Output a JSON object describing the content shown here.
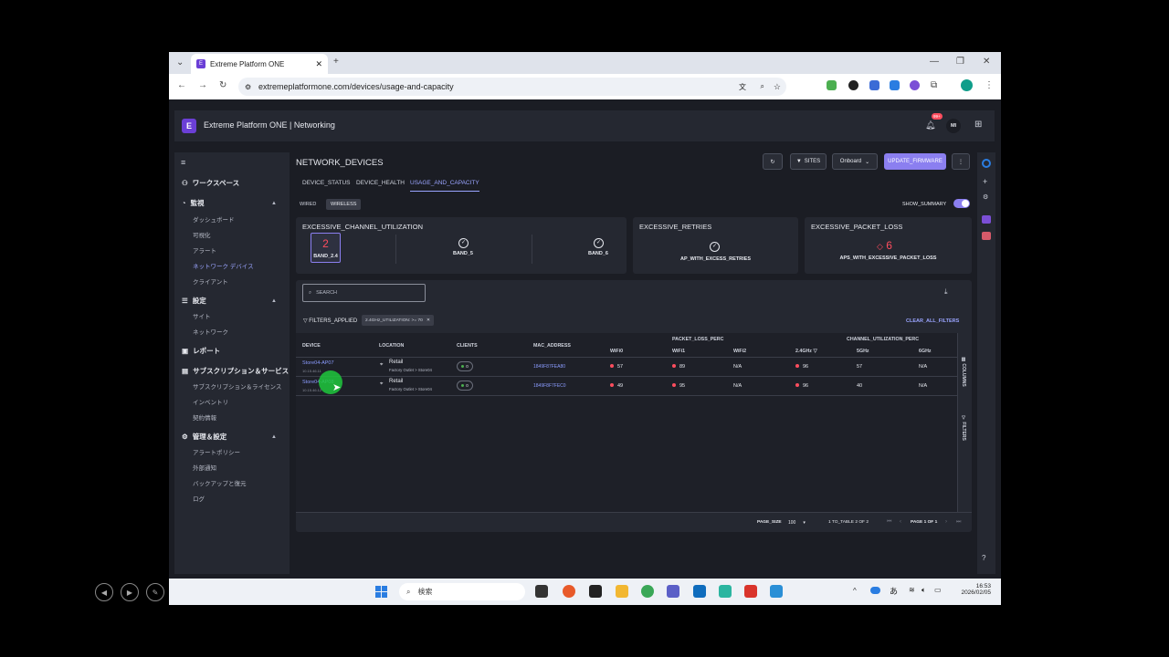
{
  "browser": {
    "tab_title": "Extreme Platform ONE",
    "url": "extremeplatformone.com/devices/usage-and-capacity"
  },
  "app": {
    "title": "Extreme Platform ONE | Networking",
    "notification_badge": "99+",
    "user_initials": "MI"
  },
  "sidebar": {
    "sections": [
      {
        "label": "ワークスペース",
        "items": []
      },
      {
        "label": "監視",
        "items": [
          "ダッシュボード",
          "可視化",
          "アラート",
          "ネットワーク デバイス",
          "クライアント"
        ]
      },
      {
        "label": "設定",
        "items": [
          "サイト",
          "ネットワーク"
        ]
      },
      {
        "label": "レポート",
        "items": []
      },
      {
        "label": "サブスクリプション＆サービス",
        "items": [
          "サブスクリプション＆ライセンス",
          "インベントリ",
          "契約情報"
        ]
      },
      {
        "label": "管理＆設定",
        "items": [
          "アラートポリシー",
          "外部通知",
          "バックアップと復元",
          "ログ"
        ]
      }
    ]
  },
  "page": {
    "title": "NETWORK_DEVICES",
    "sites_btn": "SITES",
    "onboard_btn": "Onboard",
    "update_btn": "UPDATE_FIRMWARE",
    "tabs": [
      "DEVICE_STATUS",
      "DEVICE_HEALTH",
      "USAGE_AND_CAPACITY"
    ],
    "subtabs": [
      "WIRED",
      "WIRELESS"
    ],
    "show_summary": "SHOW_SUMMARY"
  },
  "summary": {
    "channel": {
      "title": "EXCESSIVE_CHANNEL_UTILIZATION",
      "band24_value": "2",
      "band24_label": "BAND_2.4",
      "band5_label": "BAND_5",
      "band6_label": "BAND_6"
    },
    "retries": {
      "title": "EXCESSIVE_RETRIES",
      "label": "AP_WITH_EXCESS_RETRIES"
    },
    "packet_loss": {
      "title": "EXCESSIVE_PACKET_LOSS",
      "value": "6",
      "label": "APS_WITH_EXCESSIVE_PACKET_LOSS"
    }
  },
  "table": {
    "search_placeholder": "SEARCH",
    "filters_applied": "FILTERS_APPLIED",
    "filter_chip": "2.4GHz_UTILIZATION: >= 70",
    "clear_filters": "CLEAR_ALL_FILTERS",
    "group_packet": "PACKET_LOSS_PERC",
    "group_channel": "CHANNEL_UTILIZATION_PERC",
    "headers": [
      "DEVICE",
      "LOCATION",
      "CLIENTS",
      "MAC_ADDRESS",
      "WiFi0",
      "WiFi1",
      "WiFi2",
      "2.4GHz",
      "5GHz",
      "6GHz"
    ],
    "rows": [
      {
        "device": "Store04-AP07",
        "ip": "10.15.46.11",
        "loc": "Retail",
        "loc_sub": "Factory Outlet > Store04",
        "clients": "0",
        "mac": "1849F87FEA80",
        "w0": "57",
        "w1": "89",
        "w2": "N/A",
        "u24": "96",
        "u5": "57",
        "u6": "N/A"
      },
      {
        "device": "Store04-AP08",
        "ip": "10.15.46.12",
        "loc": "Retail",
        "loc_sub": "Factory Outlet > Store04",
        "clients": "0",
        "mac": "1849F8F7FEC0",
        "w0": "49",
        "w1": "95",
        "w2": "N/A",
        "u24": "96",
        "u5": "40",
        "u6": "N/A"
      }
    ],
    "side_columns": "COLUMNS",
    "side_filters": "FILTERS",
    "page_size_label": "PAGE_SIZE",
    "page_size": "100",
    "range": "1 TO_TABLE 2 OF 2",
    "page": "PAGE 1 OF 1"
  },
  "taskbar": {
    "search": "検索",
    "time": "16:53",
    "date": "2026/02/05",
    "ime": "あ"
  }
}
